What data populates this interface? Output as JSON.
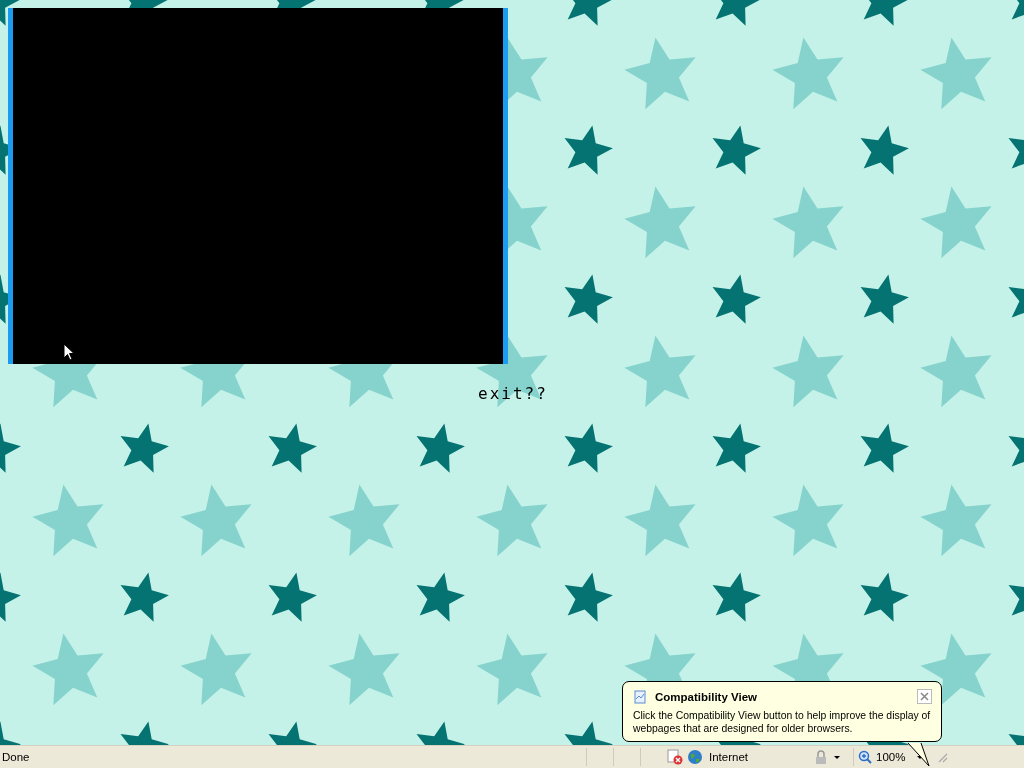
{
  "page": {
    "link": "exit??"
  },
  "balloon": {
    "title": "Compatibility View",
    "message": "Click the Compatibility View button to help improve the display of webpages that are designed for older browsers."
  },
  "status_bar": {
    "status": "Done",
    "zone": "Internet",
    "zoom": "100%"
  }
}
